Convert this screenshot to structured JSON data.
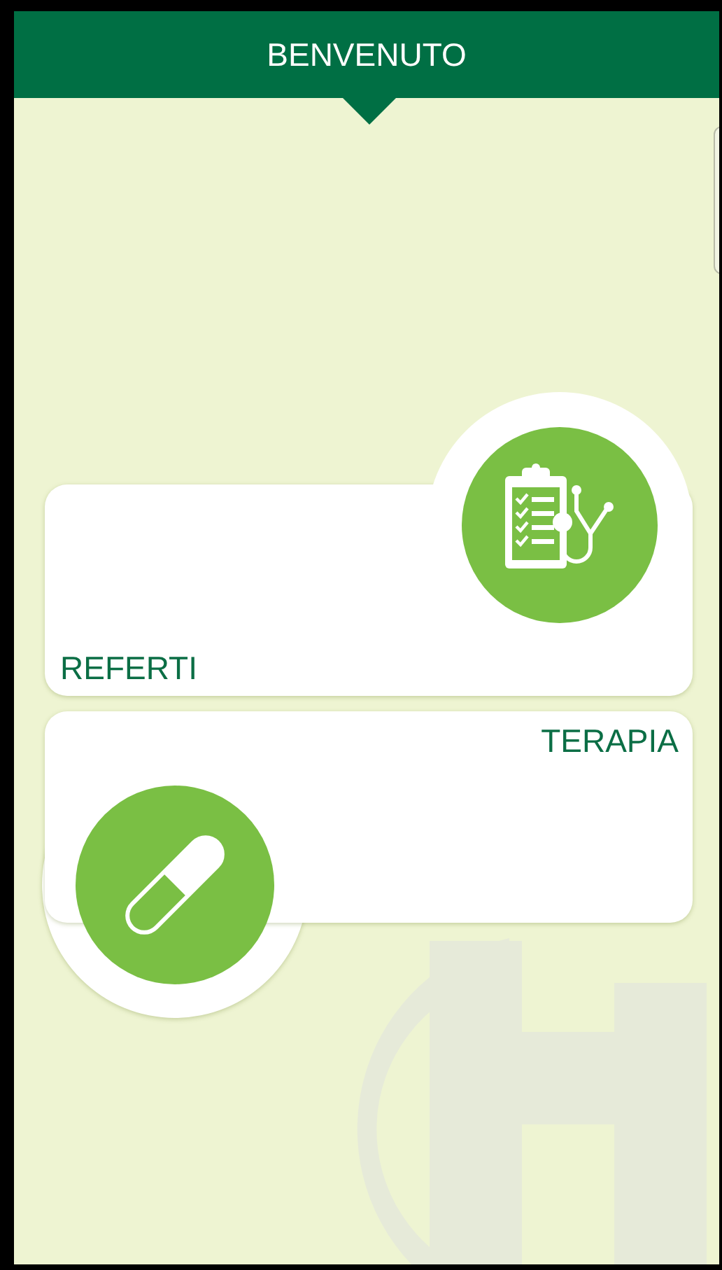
{
  "header": {
    "title": "BENVENUTO"
  },
  "menu": [
    {
      "label": "REFERTI",
      "kind": "reports"
    },
    {
      "label": "TERAPIA",
      "kind": "therapy"
    }
  ]
}
